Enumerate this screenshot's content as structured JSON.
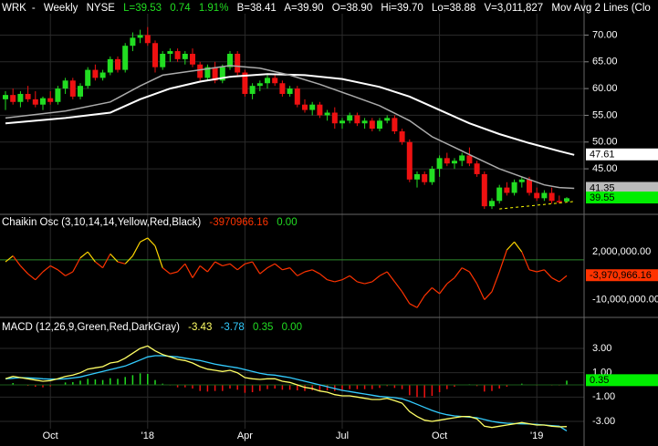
{
  "header": {
    "symbol": "WRK",
    "period": "Weekly",
    "exchange": "NYSE",
    "last": "L=39.53",
    "change": "0.74",
    "change_pct": "1.91%",
    "bid": "B=38.41",
    "ask": "A=39.90",
    "open": "O=38.90",
    "high": "Hi=39.70",
    "low": "Lo=38.88",
    "volume": "V=3,011,827",
    "study": "Mov Avg 2 Lines (Clo"
  },
  "chaikin_header": {
    "label": "Chaikin Osc (3,10,14,14,Yellow,Red,Black)",
    "value": "-3970966.16",
    "zero": "0.00"
  },
  "macd_header": {
    "label": "MACD (12,26,9,Green,Red,DarkGray)",
    "macd": "-3.43",
    "signal": "-3.78",
    "hist": "0.35",
    "zero": "0.00"
  },
  "colors": {
    "up": "#22dd22",
    "down": "#ee1111",
    "ma_fast": "#aaaaaa",
    "ma_slow": "#ffffff",
    "osc_pos": "#ffd700",
    "osc_neg": "#ff3300",
    "macd_line": "#ffff66",
    "signal_line": "#33ccff",
    "grid": "#2a2a2a",
    "zero_line": "#2c8a2c"
  },
  "x_axis": {
    "labels": [
      {
        "text": "Oct",
        "week": 6
      },
      {
        "text": "'18",
        "week": 19
      },
      {
        "text": "Apr",
        "week": 32
      },
      {
        "text": "Jul",
        "week": 45
      },
      {
        "text": "Oct",
        "week": 58
      },
      {
        "text": "'19",
        "week": 71
      }
    ]
  },
  "chart_data": [
    {
      "type": "candlestick",
      "name": "price",
      "ylim": [
        37,
        74
      ],
      "yticks": [
        "70.00",
        "65.00",
        "60.00",
        "55.00",
        "50.00",
        "45.00"
      ],
      "price_labels": [
        {
          "text": "47.61",
          "value": 47.61,
          "bg": "#ffffff",
          "fg": "#000000"
        },
        {
          "text": "41.35",
          "value": 41.35,
          "bg": "#bbbbbb",
          "fg": "#000000"
        },
        {
          "text": "39.55",
          "value": 39.55,
          "bg": "#00ee00",
          "fg": "#000000"
        }
      ],
      "ohlc": [
        [
          58.0,
          59.5,
          56.0,
          58.8
        ],
        [
          58.8,
          60.0,
          57.0,
          57.5
        ],
        [
          57.5,
          59.5,
          56.5,
          59.0
        ],
        [
          59.0,
          60.5,
          57.5,
          58.0
        ],
        [
          58.0,
          59.5,
          56.5,
          57.0
        ],
        [
          57.0,
          58.5,
          56.0,
          58.2
        ],
        [
          58.2,
          59.5,
          57.0,
          57.5
        ],
        [
          57.5,
          60.5,
          57.0,
          60.0
        ],
        [
          60.0,
          62.0,
          59.0,
          61.5
        ],
        [
          61.5,
          62.0,
          58.0,
          58.5
        ],
        [
          58.5,
          61.0,
          58.0,
          60.5
        ],
        [
          60.5,
          64.0,
          60.0,
          63.5
        ],
        [
          63.5,
          64.5,
          61.5,
          62.0
        ],
        [
          62.0,
          63.5,
          61.5,
          63.0
        ],
        [
          63.0,
          66.0,
          62.5,
          65.5
        ],
        [
          65.5,
          66.0,
          63.0,
          63.5
        ],
        [
          63.5,
          68.5,
          63.0,
          68.0
        ],
        [
          68.0,
          70.5,
          67.0,
          69.5
        ],
        [
          69.5,
          71.0,
          68.5,
          70.0
        ],
        [
          70.0,
          71.5,
          68.0,
          68.5
        ],
        [
          68.5,
          69.0,
          63.0,
          64.0
        ],
        [
          64.0,
          67.0,
          63.5,
          66.5
        ],
        [
          66.5,
          67.5,
          65.0,
          67.0
        ],
        [
          67.0,
          67.5,
          65.0,
          65.5
        ],
        [
          65.5,
          67.0,
          64.5,
          66.5
        ],
        [
          66.5,
          67.5,
          64.0,
          64.5
        ],
        [
          64.5,
          65.0,
          61.5,
          62.0
        ],
        [
          62.0,
          64.5,
          61.5,
          64.0
        ],
        [
          64.0,
          65.0,
          61.0,
          61.5
        ],
        [
          61.5,
          64.5,
          61.0,
          64.0
        ],
        [
          64.0,
          67.0,
          63.5,
          66.5
        ],
        [
          66.5,
          67.0,
          62.5,
          63.0
        ],
        [
          63.0,
          63.5,
          58.5,
          59.0
        ],
        [
          59.0,
          61.0,
          58.0,
          60.5
        ],
        [
          60.5,
          61.5,
          59.5,
          61.0
        ],
        [
          61.0,
          62.5,
          60.0,
          62.0
        ],
        [
          62.0,
          62.5,
          60.5,
          61.0
        ],
        [
          61.0,
          61.5,
          58.5,
          59.0
        ],
        [
          59.0,
          60.5,
          58.5,
          60.0
        ],
        [
          60.0,
          60.5,
          56.5,
          57.0
        ],
        [
          57.0,
          58.0,
          55.5,
          56.0
        ],
        [
          56.0,
          57.5,
          55.0,
          57.0
        ],
        [
          57.0,
          57.5,
          54.5,
          55.0
        ],
        [
          55.0,
          56.0,
          54.0,
          55.5
        ],
        [
          55.5,
          56.5,
          52.5,
          53.5
        ],
        [
          53.5,
          54.5,
          52.5,
          54.0
        ],
        [
          54.0,
          55.5,
          53.5,
          55.0
        ],
        [
          55.0,
          55.5,
          53.0,
          53.5
        ],
        [
          53.5,
          54.5,
          52.5,
          54.0
        ],
        [
          54.0,
          54.5,
          52.0,
          52.5
        ],
        [
          52.5,
          54.5,
          52.0,
          54.0
        ],
        [
          54.0,
          55.0,
          53.5,
          54.5
        ],
        [
          54.5,
          55.0,
          51.5,
          52.0
        ],
        [
          52.0,
          52.5,
          49.5,
          50.0
        ],
        [
          50.0,
          50.5,
          42.5,
          43.0
        ],
        [
          43.0,
          44.5,
          41.5,
          44.0
        ],
        [
          44.0,
          44.5,
          42.0,
          42.5
        ],
        [
          42.5,
          45.5,
          42.0,
          45.0
        ],
        [
          45.0,
          47.5,
          43.5,
          47.0
        ],
        [
          47.0,
          48.0,
          45.5,
          46.0
        ],
        [
          46.0,
          47.0,
          45.0,
          46.5
        ],
        [
          46.5,
          48.0,
          45.5,
          47.5
        ],
        [
          47.5,
          49.0,
          45.5,
          46.0
        ],
        [
          46.0,
          46.5,
          43.5,
          44.0
        ],
        [
          44.0,
          44.5,
          37.5,
          38.0
        ],
        [
          38.0,
          39.5,
          37.5,
          39.0
        ],
        [
          39.0,
          42.0,
          38.5,
          41.5
        ],
        [
          41.5,
          42.5,
          40.0,
          40.5
        ],
        [
          40.5,
          43.0,
          40.0,
          42.5
        ],
        [
          42.5,
          43.5,
          41.5,
          43.0
        ],
        [
          43.0,
          43.5,
          40.0,
          40.5
        ],
        [
          40.5,
          41.5,
          39.0,
          39.5
        ],
        [
          39.5,
          41.0,
          39.0,
          40.5
        ],
        [
          40.5,
          41.5,
          38.5,
          39.0
        ],
        [
          39.0,
          40.0,
          38.5,
          38.8
        ],
        [
          38.9,
          39.7,
          38.9,
          39.5
        ]
      ],
      "ma_fast": [
        [
          0,
          54.5
        ],
        [
          8,
          55.8
        ],
        [
          14,
          57.5
        ],
        [
          18,
          60.5
        ],
        [
          21,
          62.5
        ],
        [
          26,
          63.5
        ],
        [
          30,
          64.3
        ],
        [
          34,
          63.8
        ],
        [
          38,
          62.5
        ],
        [
          42,
          60.8
        ],
        [
          46,
          58.8
        ],
        [
          50,
          56.8
        ],
        [
          54,
          54.0
        ],
        [
          57,
          51.0
        ],
        [
          60,
          49.0
        ],
        [
          63,
          47.0
        ],
        [
          66,
          45.0
        ],
        [
          69,
          43.5
        ],
        [
          72,
          42.0
        ],
        [
          74,
          41.5
        ],
        [
          76,
          41.35
        ]
      ],
      "ma_slow": [
        [
          0,
          53.5
        ],
        [
          8,
          54.5
        ],
        [
          14,
          55.5
        ],
        [
          18,
          58.0
        ],
        [
          22,
          60.0
        ],
        [
          26,
          61.3
        ],
        [
          30,
          62.2
        ],
        [
          35,
          62.7
        ],
        [
          40,
          62.5
        ],
        [
          45,
          61.8
        ],
        [
          50,
          60.3
        ],
        [
          54,
          58.5
        ],
        [
          58,
          56.0
        ],
        [
          62,
          53.5
        ],
        [
          66,
          51.5
        ],
        [
          70,
          49.8
        ],
        [
          74,
          48.3
        ],
        [
          76,
          47.61
        ]
      ],
      "support_line": [
        [
          66,
          37.5
        ],
        [
          76,
          38.9
        ]
      ]
    },
    {
      "type": "line",
      "name": "Chaikin Osc",
      "ylim": [
        -14000000,
        8000000
      ],
      "yticks": [
        "2,000,000.00",
        "-10,000,000.00"
      ],
      "last_label": {
        "text": "-3,970,966.16",
        "value": -3970966.16
      },
      "values": [
        -500000,
        1000000,
        -1500000,
        -3500000,
        -5000000,
        -3000000,
        -1500000,
        -2500000,
        -4000000,
        -3000000,
        500000,
        2000000,
        -500000,
        -2000000,
        1500000,
        -500000,
        -1000000,
        1000000,
        4500000,
        5500000,
        3500000,
        -2000000,
        -3500000,
        -3000000,
        -1000000,
        -4500000,
        -1500000,
        -3000000,
        -500000,
        -1500000,
        -1000000,
        -2500000,
        -1000000,
        -500000,
        -3500000,
        -2000000,
        -1000000,
        -2500000,
        -2000000,
        -4000000,
        -3000000,
        -2500000,
        -3500000,
        -5000000,
        -5500000,
        -5000000,
        -4000000,
        -5500000,
        -6000000,
        -5500000,
        -4000000,
        -3000000,
        -5500000,
        -8000000,
        -11000000,
        -12000000,
        -9000000,
        -7000000,
        -8500000,
        -6000000,
        -4500000,
        -2000000,
        -3000000,
        -6000000,
        -10000000,
        -8000000,
        -3000000,
        2500000,
        4500000,
        2000000,
        -2500000,
        -3000000,
        -2500000,
        -4500000,
        -5500000,
        -3970966
      ]
    },
    {
      "type": "line",
      "name": "MACD",
      "ylim": [
        -4.8,
        4.2
      ],
      "yticks": [
        "3.00",
        "1.00",
        "-1.00",
        "-3.00"
      ],
      "labels": [
        {
          "text": "0.35",
          "value": 0.35
        }
      ],
      "macd": [
        0.5,
        0.7,
        0.6,
        0.5,
        0.4,
        0.3,
        0.35,
        0.5,
        0.7,
        0.8,
        1.0,
        1.3,
        1.4,
        1.5,
        1.8,
        1.9,
        2.2,
        2.6,
        3.0,
        3.2,
        2.8,
        2.5,
        2.3,
        2.1,
        2.0,
        1.8,
        1.5,
        1.3,
        1.2,
        1.1,
        1.2,
        1.0,
        0.6,
        0.5,
        0.45,
        0.5,
        0.5,
        0.3,
        0.2,
        0.0,
        -0.2,
        -0.3,
        -0.5,
        -0.6,
        -0.8,
        -0.9,
        -0.9,
        -1.0,
        -1.1,
        -1.2,
        -1.2,
        -1.1,
        -1.3,
        -1.5,
        -2.2,
        -2.6,
        -2.9,
        -3.0,
        -2.9,
        -2.8,
        -2.7,
        -2.6,
        -2.6,
        -2.8,
        -3.4,
        -3.5,
        -3.4,
        -3.3,
        -3.2,
        -3.1,
        -3.2,
        -3.3,
        -3.3,
        -3.4,
        -3.45,
        -3.43
      ],
      "signal": [
        0.5,
        0.55,
        0.6,
        0.58,
        0.55,
        0.5,
        0.47,
        0.47,
        0.5,
        0.57,
        0.65,
        0.8,
        0.95,
        1.1,
        1.25,
        1.4,
        1.55,
        1.8,
        2.05,
        2.3,
        2.4,
        2.4,
        2.35,
        2.3,
        2.2,
        2.1,
        2.0,
        1.85,
        1.7,
        1.6,
        1.5,
        1.4,
        1.25,
        1.1,
        0.95,
        0.85,
        0.8,
        0.7,
        0.6,
        0.45,
        0.3,
        0.15,
        0.0,
        -0.15,
        -0.3,
        -0.45,
        -0.55,
        -0.65,
        -0.75,
        -0.85,
        -0.95,
        -1.0,
        -1.05,
        -1.15,
        -1.35,
        -1.6,
        -1.85,
        -2.1,
        -2.3,
        -2.45,
        -2.55,
        -2.6,
        -2.65,
        -2.7,
        -2.85,
        -3.0,
        -3.1,
        -3.15,
        -3.18,
        -3.2,
        -3.22,
        -3.25,
        -3.3,
        -3.35,
        -3.4,
        -3.78
      ]
    }
  ]
}
